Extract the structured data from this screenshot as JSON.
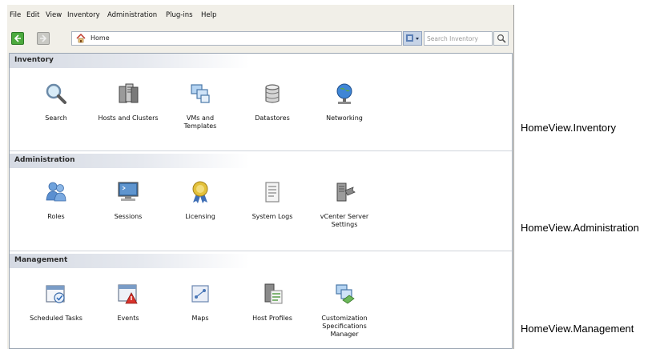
{
  "menu": [
    "File",
    "Edit",
    "View",
    "Inventory",
    "Administration",
    "Plug-ins",
    "Help"
  ],
  "address": {
    "text": "Home"
  },
  "search": {
    "placeholder": "Search Inventory"
  },
  "sections": [
    {
      "title": "Inventory",
      "items": [
        {
          "label": "Search",
          "icon": "magnifier-icon"
        },
        {
          "label": "Hosts and Clusters",
          "icon": "server-cluster-icon"
        },
        {
          "label": "VMs and\nTemplates",
          "icon": "vm-templates-icon"
        },
        {
          "label": "Datastores",
          "icon": "datastore-icon"
        },
        {
          "label": "Networking",
          "icon": "network-globe-icon"
        }
      ]
    },
    {
      "title": "Administration",
      "items": [
        {
          "label": "Roles",
          "icon": "users-roles-icon"
        },
        {
          "label": "Sessions",
          "icon": "monitor-session-icon"
        },
        {
          "label": "Licensing",
          "icon": "license-badge-icon"
        },
        {
          "label": "System Logs",
          "icon": "log-document-icon"
        },
        {
          "label": "vCenter Server\nSettings",
          "icon": "server-settings-icon"
        }
      ]
    },
    {
      "title": "Management",
      "items": [
        {
          "label": "Scheduled Tasks",
          "icon": "scheduled-tasks-icon"
        },
        {
          "label": "Events",
          "icon": "events-alert-icon"
        },
        {
          "label": "Maps",
          "icon": "maps-icon"
        },
        {
          "label": "Host Profiles",
          "icon": "host-profiles-icon"
        },
        {
          "label": "Customization\nSpecifications\nManager",
          "icon": "customization-spec-icon"
        }
      ]
    }
  ],
  "captions": [
    "HomeView.Inventory",
    "HomeView.Administration",
    "HomeView.Management"
  ]
}
